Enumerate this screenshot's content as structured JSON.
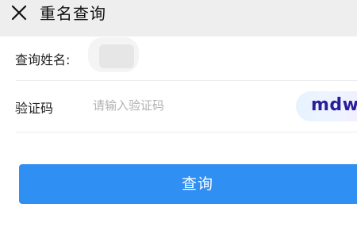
{
  "header": {
    "close_icon": "close-icon",
    "title": "重名查询"
  },
  "form": {
    "name_row": {
      "label": "查询姓名:"
    },
    "captcha_row": {
      "label": "验证码",
      "input_value": "",
      "placeholder": "请输入验证码",
      "captcha_text": "mdw"
    }
  },
  "actions": {
    "query_label": "查询"
  },
  "colors": {
    "header_bg": "#eeeeee",
    "button_bg": "#2f8ff2",
    "captcha_text": "#2a1e9a"
  }
}
